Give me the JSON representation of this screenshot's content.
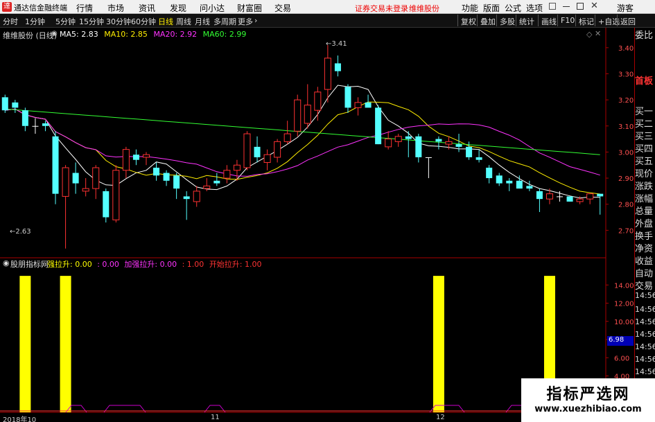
{
  "menubar": {
    "app_title": "通达信金融终端",
    "menus": [
      "行情",
      "市场",
      "资讯",
      "发现",
      "问小达",
      "财富圈",
      "交易"
    ],
    "notice": "证券交易未登录",
    "stock_name": "维维股份",
    "right_menus": [
      "功能",
      "版面",
      "公式",
      "选项"
    ],
    "guest": "游客"
  },
  "toolbar": {
    "periods": [
      "分时",
      "1分钟",
      "5分钟",
      "15分钟",
      "30分钟",
      "60分钟",
      "日线",
      "周线",
      "月线",
      "多周期",
      "更多"
    ],
    "active_period": "日线",
    "right_buttons": [
      "复权",
      "叠加",
      "多股",
      "统计",
      "画线",
      "F10",
      "标记",
      "+自选",
      "返回"
    ]
  },
  "main_chart": {
    "title": "维维股份 (日线)",
    "ma_labels": [
      {
        "text": "MA5: 2.83",
        "color": "#ffffff"
      },
      {
        "text": "MA10: 2.85",
        "color": "#ffee00"
      },
      {
        "text": "MA20: 2.92",
        "color": "#ff33ff"
      },
      {
        "text": "MA60: 2.99",
        "color": "#33ff33"
      }
    ],
    "high_label": "3.41",
    "low_label": "2.63",
    "y_ticks": [
      "3.40",
      "3.30",
      "3.20",
      "3.10",
      "3.00",
      "2.90",
      "2.80",
      "2.70"
    ]
  },
  "indicator": {
    "title": "股朋指标网",
    "items": [
      {
        "text": "强拉升: 0.00",
        "color": "#ffff00"
      },
      {
        "text": ": 0.00",
        "color": "#ff33ff"
      },
      {
        "text": "加强拉升: 0.00",
        "color": "#ff33ff"
      },
      {
        "text": ": 1.00",
        "color": "#ff3333"
      },
      {
        "text": "开始拉升: 1.00",
        "color": "#ff3333"
      }
    ],
    "y_ticks": [
      "14.00",
      "12.00",
      "10.00",
      "8.00",
      "6.00",
      "4.00"
    ],
    "current_value": "6.98"
  },
  "x_axis": [
    "2018年10",
    "11",
    "12"
  ],
  "right_panel": {
    "labels": [
      "委比",
      "首板",
      "买一",
      "买二",
      "买三",
      "买四",
      "买五",
      "现价",
      "涨跌",
      "涨幅",
      "总量",
      "外盘",
      "换手",
      "净资",
      "收益",
      "自动",
      "交易",
      "14:56",
      "14:56",
      "14:56",
      "14:56",
      "14:56",
      "14:56",
      "14:56",
      "14:56",
      "14:56"
    ],
    "label_colors": {
      "首板": "#ff3333"
    }
  },
  "watermark": {
    "line1": "指标严选网",
    "line2": "www.xuezhibiao.com"
  },
  "chart_data": {
    "type": "candlestick",
    "ylim": [
      2.6,
      3.45
    ],
    "candles": [
      {
        "o": 3.21,
        "h": 3.22,
        "l": 3.15,
        "c": 3.16
      },
      {
        "o": 3.19,
        "h": 3.2,
        "l": 3.15,
        "c": 3.17
      },
      {
        "o": 3.16,
        "h": 3.17,
        "l": 3.08,
        "c": 3.1
      },
      {
        "o": 3.1,
        "h": 3.13,
        "l": 3.07,
        "c": 3.1
      },
      {
        "o": 3.11,
        "h": 3.12,
        "l": 3.08,
        "c": 3.1
      },
      {
        "o": 3.06,
        "h": 3.08,
        "l": 2.8,
        "c": 2.84
      },
      {
        "o": 2.83,
        "h": 2.95,
        "l": 2.63,
        "c": 2.94
      },
      {
        "o": 2.92,
        "h": 2.96,
        "l": 2.84,
        "c": 2.88
      },
      {
        "o": 2.85,
        "h": 2.9,
        "l": 2.83,
        "c": 2.86
      },
      {
        "o": 2.86,
        "h": 2.95,
        "l": 2.82,
        "c": 2.94
      },
      {
        "o": 2.85,
        "h": 2.86,
        "l": 2.73,
        "c": 2.75
      },
      {
        "o": 2.74,
        "h": 2.95,
        "l": 2.73,
        "c": 2.93
      },
      {
        "o": 2.93,
        "h": 3.02,
        "l": 2.9,
        "c": 3.01
      },
      {
        "o": 2.99,
        "h": 3.01,
        "l": 2.95,
        "c": 2.97
      },
      {
        "o": 2.98,
        "h": 3.0,
        "l": 2.95,
        "c": 2.99
      },
      {
        "o": 2.94,
        "h": 2.96,
        "l": 2.89,
        "c": 2.91
      },
      {
        "o": 2.92,
        "h": 2.93,
        "l": 2.87,
        "c": 2.89
      },
      {
        "o": 2.91,
        "h": 2.92,
        "l": 2.82,
        "c": 2.86
      },
      {
        "o": 2.83,
        "h": 2.85,
        "l": 2.74,
        "c": 2.82
      },
      {
        "o": 2.81,
        "h": 2.87,
        "l": 2.79,
        "c": 2.85
      },
      {
        "o": 2.86,
        "h": 2.9,
        "l": 2.85,
        "c": 2.87
      },
      {
        "o": 2.89,
        "h": 2.92,
        "l": 2.87,
        "c": 2.88
      },
      {
        "o": 2.9,
        "h": 2.95,
        "l": 2.88,
        "c": 2.93
      },
      {
        "o": 2.93,
        "h": 2.97,
        "l": 2.89,
        "c": 2.95
      },
      {
        "o": 2.94,
        "h": 3.08,
        "l": 2.93,
        "c": 3.07
      },
      {
        "o": 3.02,
        "h": 3.06,
        "l": 2.96,
        "c": 2.98
      },
      {
        "o": 2.96,
        "h": 3.01,
        "l": 2.93,
        "c": 2.99
      },
      {
        "o": 2.98,
        "h": 3.05,
        "l": 2.96,
        "c": 3.04
      },
      {
        "o": 3.04,
        "h": 3.12,
        "l": 3.03,
        "c": 3.07
      },
      {
        "o": 3.08,
        "h": 3.22,
        "l": 3.06,
        "c": 3.2
      },
      {
        "o": 3.11,
        "h": 3.26,
        "l": 3.09,
        "c": 3.18
      },
      {
        "o": 3.16,
        "h": 3.25,
        "l": 3.12,
        "c": 3.23
      },
      {
        "o": 3.24,
        "h": 3.41,
        "l": 3.19,
        "c": 3.36
      },
      {
        "o": 3.34,
        "h": 3.37,
        "l": 3.29,
        "c": 3.31
      },
      {
        "o": 3.25,
        "h": 3.26,
        "l": 3.15,
        "c": 3.17
      },
      {
        "o": 3.17,
        "h": 3.21,
        "l": 3.14,
        "c": 3.19
      },
      {
        "o": 3.19,
        "h": 3.22,
        "l": 3.18,
        "c": 3.17
      },
      {
        "o": 3.17,
        "h": 3.18,
        "l": 3.03,
        "c": 3.03
      },
      {
        "o": 3.02,
        "h": 3.08,
        "l": 3.01,
        "c": 3.05
      },
      {
        "o": 3.04,
        "h": 3.07,
        "l": 3.02,
        "c": 3.06
      },
      {
        "o": 3.06,
        "h": 3.08,
        "l": 2.98,
        "c": 3.05
      },
      {
        "o": 3.06,
        "h": 3.07,
        "l": 2.96,
        "c": 2.98
      },
      {
        "o": 2.98,
        "h": 2.98,
        "l": 2.9,
        "c": 2.98
      },
      {
        "o": 3.05,
        "h": 3.06,
        "l": 3.01,
        "c": 3.04
      },
      {
        "o": 3.03,
        "h": 3.06,
        "l": 3.01,
        "c": 3.04
      },
      {
        "o": 3.03,
        "h": 3.07,
        "l": 3.0,
        "c": 3.02
      },
      {
        "o": 3.02,
        "h": 3.04,
        "l": 2.97,
        "c": 2.98
      },
      {
        "o": 2.98,
        "h": 3.01,
        "l": 2.96,
        "c": 2.97
      },
      {
        "o": 2.94,
        "h": 2.95,
        "l": 2.88,
        "c": 2.9
      },
      {
        "o": 2.91,
        "h": 2.92,
        "l": 2.87,
        "c": 2.88
      },
      {
        "o": 2.89,
        "h": 2.9,
        "l": 2.85,
        "c": 2.88
      },
      {
        "o": 2.89,
        "h": 2.91,
        "l": 2.87,
        "c": 2.86
      },
      {
        "o": 2.87,
        "h": 2.89,
        "l": 2.85,
        "c": 2.86
      },
      {
        "o": 2.85,
        "h": 2.86,
        "l": 2.77,
        "c": 2.82
      },
      {
        "o": 2.82,
        "h": 2.86,
        "l": 2.8,
        "c": 2.84
      },
      {
        "o": 2.83,
        "h": 2.85,
        "l": 2.81,
        "c": 2.83
      },
      {
        "o": 2.83,
        "h": 2.83,
        "l": 2.81,
        "c": 2.81
      },
      {
        "o": 2.81,
        "h": 2.83,
        "l": 2.8,
        "c": 2.82
      },
      {
        "o": 2.82,
        "h": 2.84,
        "l": 2.8,
        "c": 2.84
      },
      {
        "o": 2.84,
        "h": 2.84,
        "l": 2.76,
        "c": 2.83
      }
    ],
    "indicator_series": {
      "name": "强拉升",
      "ylim": [
        0,
        16
      ],
      "bar_indices": [
        2,
        6,
        43,
        54
      ],
      "bar_value": 15
    },
    "colors": {
      "up": "#ff3232",
      "down": "#54ffff",
      "flat": "#ffffff"
    }
  }
}
